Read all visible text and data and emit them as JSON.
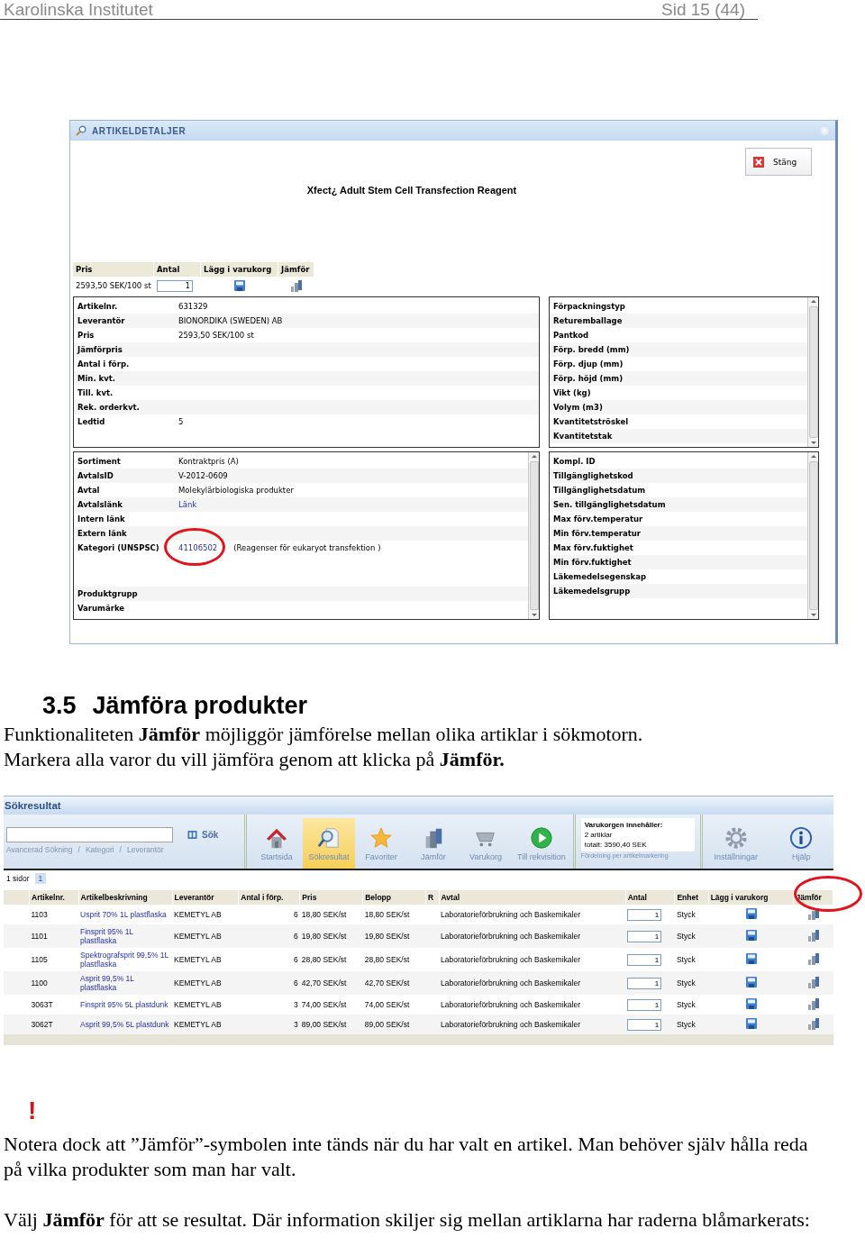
{
  "page_header": {
    "left": "Karolinska Institutet",
    "right": "Sid 15 (44)"
  },
  "article_details": {
    "title": "ARTIKELDETALJER",
    "close_button": "Stäng",
    "product_name": "Xfect¿ Adult Stem Cell Transfection Reagent",
    "price_table": {
      "columns": [
        "Pris",
        "Antal",
        "Lägg i varukorg",
        "Jämför"
      ],
      "price": "2593,50 SEK/100 st",
      "quantity": "1"
    },
    "panels": [
      {
        "rows": [
          {
            "label": "Artikelnr.",
            "value": "631329"
          },
          {
            "label": "Leverantör",
            "value": "BIONORDIKA (SWEDEN) AB"
          },
          {
            "label": "Pris",
            "value": "2593,50 SEK/100 st"
          },
          {
            "label": "Jämförpris"
          },
          {
            "label": "Antal i förp."
          },
          {
            "label": "Min. kvt."
          },
          {
            "label": "Till. kvt."
          },
          {
            "label": "Rek. orderkvt."
          },
          {
            "label": "Ledtid",
            "value": "5"
          }
        ]
      },
      {
        "rows": [
          {
            "label": "Förpackningstyp"
          },
          {
            "label": "Returemballage"
          },
          {
            "label": "Pantkod"
          },
          {
            "label": "Förp. bredd (mm)"
          },
          {
            "label": "Förp. djup (mm)"
          },
          {
            "label": "Förp. höjd (mm)"
          },
          {
            "label": "Vikt (kg)"
          },
          {
            "label": "Volym (m3)"
          },
          {
            "label": "Kvantitetströskel"
          },
          {
            "label": "Kvantitetstak"
          }
        ]
      },
      {
        "rows": [
          {
            "label": "Sortiment",
            "value": "Kontraktpris (A)"
          },
          {
            "label": "AvtalsID",
            "value": "V-2012-0609"
          },
          {
            "label": "Avtal",
            "value": "Molekylärbiologiska produkter"
          },
          {
            "label": "Avtalslänk",
            "link": "Länk"
          },
          {
            "label": "Intern länk"
          },
          {
            "label": "Extern länk"
          },
          {
            "label": "Kategori (UNSPSC)",
            "link": "41106502",
            "value": "(Reagenser för eukaryot transfektion )",
            "tall": true
          },
          {
            "label": "Produktgrupp"
          },
          {
            "label": "Varumärke"
          }
        ]
      },
      {
        "rows": [
          {
            "label": "Kompl. ID"
          },
          {
            "label": "Tillgänglighetskod"
          },
          {
            "label": "Tillgänglighetsdatum"
          },
          {
            "label": "Sen. tillgänglighetsdatum"
          },
          {
            "label": "Max förv.temperatur"
          },
          {
            "label": "Min förv.temperatur"
          },
          {
            "label": "Max förv.fuktighet"
          },
          {
            "label": "Min förv.fuktighet"
          },
          {
            "label": "Läkemedelsegenskap"
          },
          {
            "label": "Läkemedelsgrupp"
          }
        ]
      }
    ]
  },
  "section": {
    "number": "3.5",
    "title": "Jämföra produkter"
  },
  "intro": [
    "Funktionaliteten **Jämför** möjliggör jämförelse mellan olika artiklar i sökmotorn.",
    "Markera alla varor du vill jämföra genom att klicka på **Jämför.**"
  ],
  "search_results": {
    "title": "Sökresultat",
    "search_button": "Sök",
    "nav_links": [
      "Avancerad Sökning",
      "/",
      "Kategori",
      "/",
      "Leverantör"
    ],
    "toolbar": [
      {
        "label": "Startsida",
        "selected": false
      },
      {
        "label": "Sökresultat",
        "selected": true
      },
      {
        "label": "Favoriter",
        "selected": false
      },
      {
        "label": "Jämför",
        "selected": false
      },
      {
        "label": "Varukorg",
        "selected": false
      },
      {
        "label": "Till rekvisition",
        "selected": false
      }
    ],
    "cart": {
      "heading": "Varukorgen innehåller:",
      "lines": [
        "2 artiklar",
        "totalt: 3590,40 SEK"
      ],
      "link": "Fördelning per artikelmarkering"
    },
    "tools": [
      {
        "label": "Inställningar"
      },
      {
        "label": "Hjälp"
      }
    ],
    "pager": {
      "label": "1 sidor",
      "pages": [
        {
          "label": "1",
          "selected": true
        }
      ]
    },
    "columns": [
      "Artikelnr.",
      "Artikelbeskrivning",
      "Leverantör",
      "Antal i förp.",
      "Pris",
      "Belopp",
      "R",
      "Avtal",
      "Antal",
      "Enhet",
      "Lägg i varukorg",
      "Jämför"
    ],
    "rows": [
      {
        "article_no": "1103",
        "description": "Usprit 70% 1L plastflaska",
        "supplier": "KEMETYL AB",
        "pack_qty": "6",
        "price": "18,80 SEK/st",
        "amount": "18,80 SEK/st",
        "agreement": "Laboratorieförbrukning och Baskemikaler",
        "quantity": "1",
        "unit": "Styck"
      },
      {
        "article_no": "1101",
        "description": "Finsprit 95% 1L plastflaska",
        "supplier": "KEMETYL AB",
        "pack_qty": "6",
        "price": "19,80 SEK/st",
        "amount": "19,80 SEK/st",
        "agreement": "Laboratorieförbrukning och Baskemikaler",
        "quantity": "1",
        "unit": "Styck"
      },
      {
        "article_no": "1105",
        "description": "Spektrografsprit 99,5% 1L plastflaska",
        "supplier": "KEMETYL AB",
        "pack_qty": "6",
        "price": "28,80 SEK/st",
        "amount": "28,80 SEK/st",
        "agreement": "Laboratorieförbrukning och Baskemikaler",
        "quantity": "1",
        "unit": "Styck"
      },
      {
        "article_no": "1100",
        "description": "Asprit 99,5% 1L plastflaska",
        "supplier": "KEMETYL AB",
        "pack_qty": "6",
        "price": "42,70 SEK/st",
        "amount": "42,70 SEK/st",
        "agreement": "Laboratorieförbrukning och Baskemikaler",
        "quantity": "1",
        "unit": "Styck"
      },
      {
        "article_no": "3063T",
        "description": "Finsprit 95% 5L plastdunk",
        "supplier": "KEMETYL AB",
        "pack_qty": "3",
        "price": "74,00 SEK/st",
        "amount": "74,00 SEK/st",
        "agreement": "Laboratorieförbrukning och Baskemikaler",
        "quantity": "1",
        "unit": "Styck"
      },
      {
        "article_no": "3062T",
        "description": "Asprit 99,5% 5L plastdunk",
        "supplier": "KEMETYL AB",
        "pack_qty": "3",
        "price": "89,00 SEK/st",
        "amount": "89,00 SEK/st",
        "agreement": "Laboratorieförbrukning och Baskemikaler",
        "quantity": "1",
        "unit": "Styck"
      }
    ]
  },
  "warning_mark": "!",
  "notes": [
    "Notera dock att ”Jämför”-symbolen inte tänds när du har valt en artikel. Man behöver själv hålla reda på vilka produkter som man har valt.",
    "Välj **Jämför** för att se resultat. Där information skiljer sig mellan artiklarna har raderna blåmarkerats:"
  ]
}
